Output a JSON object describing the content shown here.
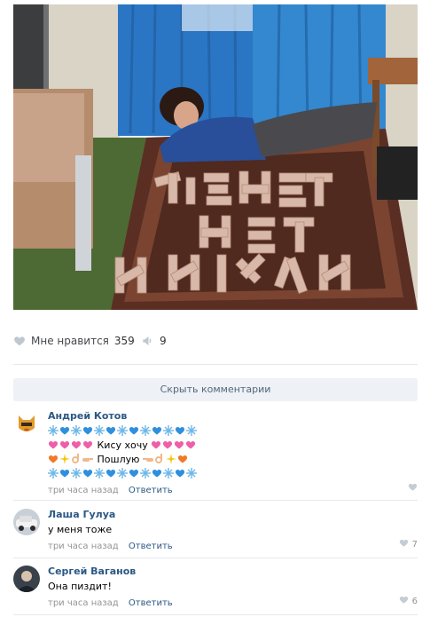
{
  "post": {
    "likes_label": "Мне нравится",
    "likes_count": "359",
    "shares_count": "9"
  },
  "hide_comments_label": "Скрыть комментарии",
  "comments": [
    {
      "author": "Андрей Котов",
      "text_line2": "Кису хочу",
      "text_line3": "Пошлую",
      "time": "три часа назад",
      "reply": "Ответить",
      "likes": ""
    },
    {
      "author": "Лаша Гулуа",
      "text": "у меня тоже",
      "time": "три часа назад",
      "reply": "Ответить",
      "likes": "7"
    },
    {
      "author": "Сергей Ваганов",
      "text": "Она пиздит!",
      "time": "три часа назад",
      "reply": "Ответить",
      "likes": "6"
    }
  ],
  "colors": {
    "link": "#2a5885",
    "meta": "#939393",
    "heart_blue": "#2f8fdf",
    "heart_pink": "#ef5fa7",
    "heart_orange": "#f07a2a"
  }
}
